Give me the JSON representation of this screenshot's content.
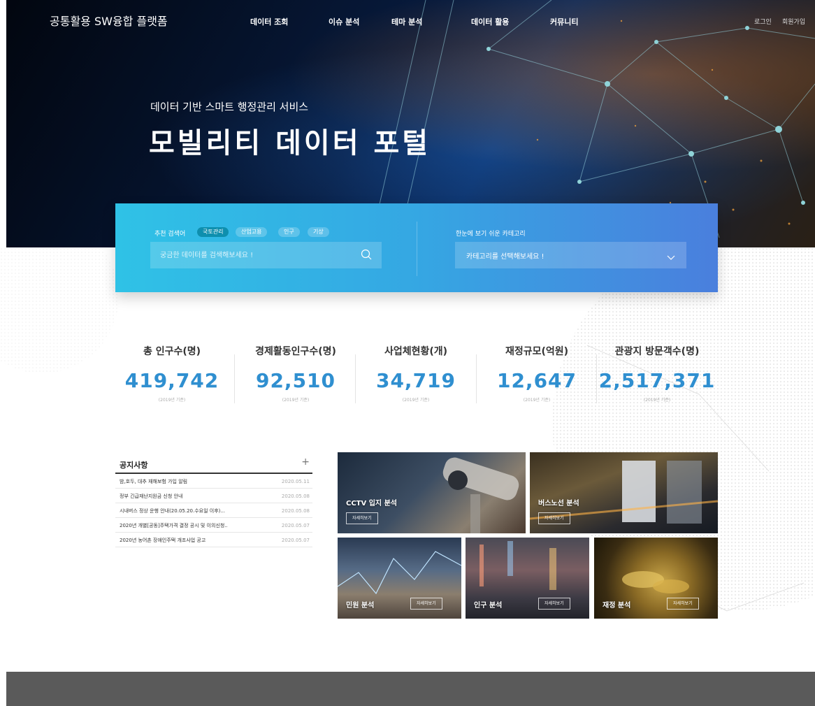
{
  "brand": "공통활용 SW융합 플랫폼",
  "nav": [
    "데이터 조회",
    "이슈 분석",
    "테마 분석",
    "데이터 활용",
    "커뮤니티"
  ],
  "util": {
    "login": "로그인",
    "join": "회원가입"
  },
  "hero": {
    "subtitle": "데이터 기반 스마트 행정관리 서비스",
    "title": "모빌리티 데이터 포털"
  },
  "search": {
    "recommend_label": "추천 검색어",
    "tags": [
      "국토관리",
      "산업고용",
      "인구",
      "기상"
    ],
    "placeholder": "궁금한 데이터를 검색해보세요 !",
    "category_label": "한눈에 보기 쉬운 카테고리",
    "category_value": "카테고리를 선택해보세요 !"
  },
  "stats": [
    {
      "label": "총 인구수(명)",
      "value": "419,742",
      "note": "(2019년 기준)"
    },
    {
      "label": "경제활동인구수(명)",
      "value": "92,510",
      "note": "(2019년 기준)"
    },
    {
      "label": "사업체현황(개)",
      "value": "34,719",
      "note": "(2019년 기준)"
    },
    {
      "label": "재정규모(억원)",
      "value": "12,647",
      "note": "(2019년 기준)"
    },
    {
      "label": "관광지 방문객수(명)",
      "value": "2,517,371",
      "note": "(2019년 기준)"
    }
  ],
  "notice": {
    "title": "공지사항",
    "more": "+",
    "rows": [
      {
        "title": "밤,호두, 대추 재해보험 가입 알림",
        "date": "2020.05.11"
      },
      {
        "title": "정부 긴급재난지원금 신청 안내",
        "date": "2020.05.08"
      },
      {
        "title": "시내버스 정상 운행 안내(20.05.20.수요일 이후)...",
        "date": "2020.05.08"
      },
      {
        "title": "2020년 개별[공동]주택가격 결정 공시 및 이의신청..",
        "date": "2020.05.07"
      },
      {
        "title": "2020년 농어촌 장애인주택 개조사업 공고",
        "date": "2020.05.07"
      }
    ]
  },
  "tiles": [
    {
      "name": "CCTV 입지 분석",
      "button": "자세히보기"
    },
    {
      "name": "버스노선 분석",
      "button": "자세히보기"
    },
    {
      "name": "민원 분석",
      "button": "자세히보기"
    },
    {
      "name": "인구 분석",
      "button": "자세히보기"
    },
    {
      "name": "재정 분석",
      "button": "자세히보기"
    }
  ],
  "colors": {
    "accent": "#2f8fd0",
    "panel_start": "#2fc2e6",
    "panel_end": "#4a7fdd",
    "footer": "#5a5a5a"
  }
}
